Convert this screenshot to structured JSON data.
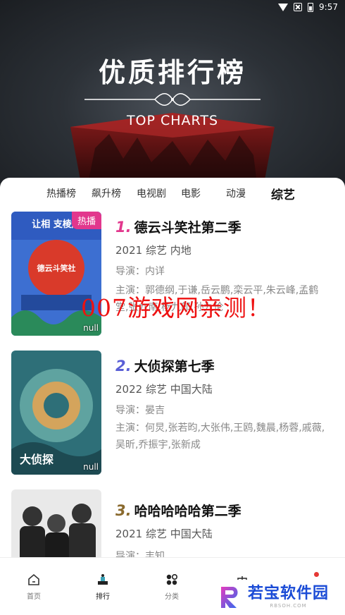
{
  "status_bar": {
    "time": "9:57"
  },
  "header": {
    "title": "优质排行榜",
    "subtitle": "TOP CHARTS"
  },
  "tabs": [
    {
      "label": "热播榜",
      "active": false
    },
    {
      "label": "飙升榜",
      "active": false
    },
    {
      "label": "电视剧",
      "active": false
    },
    {
      "label": "电影",
      "active": false
    },
    {
      "label": "动漫",
      "active": false
    },
    {
      "label": "综艺",
      "active": true
    }
  ],
  "items": [
    {
      "rank": "1.",
      "rank_color": "#e2378d",
      "title": "德云斗笑社第二季",
      "meta": "2021  综艺  内地",
      "director": "导演：内详",
      "cast": "主演：郭德纲,于谦,岳云鹏,栾云平,朱云峰,孟鹤堂,张九南,杨九郎,孙九伦",
      "badge": "热播",
      "poster_null": "null",
      "poster_text": "让相 支棱起",
      "poster_text2": "德云斗笑社"
    },
    {
      "rank": "2.",
      "rank_color": "#5a5fd6",
      "title": "大侦探第七季",
      "meta": "2022  综艺  中国大陆",
      "director": "导演：晏吉",
      "cast": "主演：何炅,张若昀,大张伟,王鸥,魏晨,杨蓉,戚薇,吴昕,乔振宇,张新成",
      "poster_null": "null",
      "poster_text": "大侦探"
    },
    {
      "rank": "3.",
      "rank_color": "#8a6a2e",
      "title": "哈哈哈哈哈第二季",
      "meta": "2021  综艺  中国大陆",
      "director": "导演：丰知"
    }
  ],
  "watermark": "007游戏网亲测！",
  "bottom_nav": [
    {
      "label": "首页",
      "icon": "home-icon",
      "active": false
    },
    {
      "label": "排行",
      "icon": "ranking-icon",
      "active": true
    },
    {
      "label": "分类",
      "icon": "category-icon",
      "active": false
    }
  ],
  "logo": {
    "text": "若宝软件园",
    "sub": "RBSOH.COM"
  }
}
